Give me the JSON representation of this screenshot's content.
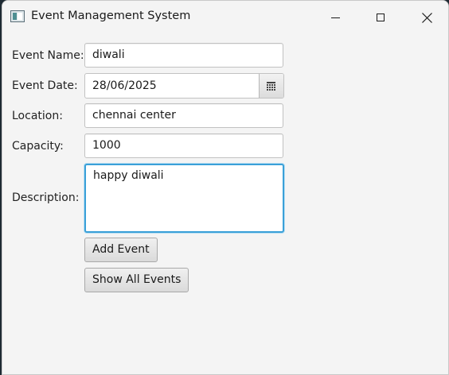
{
  "window": {
    "title": "Event Management System",
    "icon": "app-window-icon"
  },
  "titlebar_controls": {
    "minimize_icon": "minimize-icon",
    "maximize_icon": "maximize-icon",
    "close_icon": "close-icon"
  },
  "form": {
    "event_name": {
      "label": "Event Name:",
      "value": "diwali"
    },
    "event_date": {
      "label": "Event Date:",
      "value": "28/06/2025",
      "picker_icon": "calendar-icon"
    },
    "location": {
      "label": "Location:",
      "value": "chennai center"
    },
    "capacity": {
      "label": "Capacity:",
      "value": "1000"
    },
    "description": {
      "label": "Description:",
      "value": "happy diwali"
    }
  },
  "actions": {
    "add_event_label": "Add Event",
    "show_all_label": "Show All Events"
  },
  "colors": {
    "focus_border": "#3aa0d8",
    "window_bg": "#f4f4f4"
  }
}
